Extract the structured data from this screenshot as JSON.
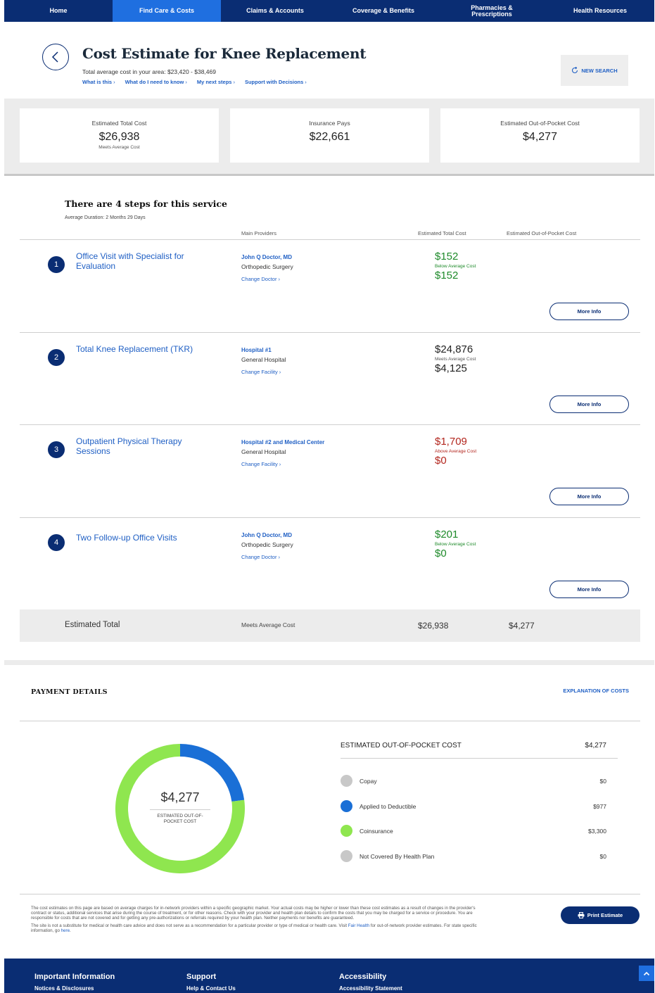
{
  "nav": {
    "items": [
      {
        "label": "Home",
        "active": false
      },
      {
        "label": "Find Care & Costs",
        "active": true
      },
      {
        "label": "Claims & Accounts",
        "active": false
      },
      {
        "label": "Coverage & Benefits",
        "active": false
      },
      {
        "label": "Pharmacies &\nPrescriptions",
        "active": false
      },
      {
        "label": "Health Resources",
        "active": false
      }
    ]
  },
  "header": {
    "title": "Cost Estimate for Knee Replacement",
    "avg_cost_text": "Total average cost in your area: $23,420 - $38,469",
    "links": [
      "What is this",
      "What do I need to know",
      "My next steps",
      "Support with Decisions"
    ],
    "new_search_label": "NEW SEARCH"
  },
  "summary": {
    "cards": [
      {
        "label": "Estimated Total Cost",
        "value": "$26,938",
        "sub": "Meets Average Cost"
      },
      {
        "label": "Insurance Pays",
        "value": "$22,661",
        "sub": ""
      },
      {
        "label": "Estimated Out-of-Pocket Cost",
        "value": "$4,277",
        "sub": ""
      }
    ]
  },
  "steps_section": {
    "title": "There are 4 steps for this service",
    "duration": "Average Duration: 2 Months 29 Days",
    "col_main_providers": "Main Providers",
    "col_total_cost": "Estimated Total Cost",
    "col_oop_cost": "Estimated Out-of-Pocket Cost",
    "more_info_label": "More Info",
    "steps": [
      {
        "number": "1",
        "name": "Office Visit with Specialist for Evaluation",
        "provider": "John Q Doctor, MD",
        "specialty": "Orthopedic Surgery",
        "change_label": "Change Doctor",
        "total": "$152",
        "note": "Below Average Cost",
        "oop": "$152",
        "status": "below"
      },
      {
        "number": "2",
        "name": "Total Knee Replacement (TKR)",
        "provider": "Hospital #1",
        "specialty": "General Hospital",
        "change_label": "Change Facility",
        "total": "$24,876",
        "note": "Meets Average Cost",
        "oop": "$4,125",
        "status": "meets"
      },
      {
        "number": "3",
        "name": "Outpatient Physical Therapy Sessions",
        "provider": "Hospital #2 and Medical Center",
        "specialty": "General Hospital",
        "change_label": "Change Facility",
        "total": "$1,709",
        "note": "Above Average Cost",
        "oop": "$0",
        "status": "above"
      },
      {
        "number": "4",
        "name": "Two Follow-up Office Visits",
        "provider": "John Q Doctor, MD",
        "specialty": "Orthopedic Surgery",
        "change_label": "Change Doctor",
        "total": "$201",
        "note": "Below Average Cost",
        "oop": "$0",
        "status": "below"
      }
    ],
    "estimated_total": {
      "label": "Estimated Total",
      "note": "Meets Average Cost",
      "total": "$26,938",
      "oop": "$4,277"
    }
  },
  "payment": {
    "title": "PAYMENT DETAILS",
    "explanation_link": "EXPLANATION OF COSTS",
    "donut_amount": "$4,277",
    "donut_label": "ESTIMATED OUT-OF-POCKET COST",
    "oop_heading": "ESTIMATED OUT-OF-POCKET COST",
    "oop_total": "$4,277",
    "breakdown": [
      {
        "label": "Copay",
        "value": "$0",
        "amount": 0,
        "color": "#c8c8c8"
      },
      {
        "label": "Applied to Deductible",
        "value": "$977",
        "amount": 977,
        "color": "#1a6fd6"
      },
      {
        "label": "Coinsurance",
        "value": "$3,300",
        "amount": 3300,
        "color": "#8fe64f"
      },
      {
        "label": "Not Covered By Health Plan",
        "value": "$0",
        "amount": 0,
        "color": "#c8c8c8"
      }
    ]
  },
  "disclaimer": {
    "para1": "The cost estimates on this page are based on average charges for in-network providers within a specific geographic market. Your actual costs may be higher or lower than these cost estimates as a result of changes in the provider's contract or status, additional services that arise during the course of treatment, or for other reasons. Check with your provider and health plan details to confirm the costs that you may be charged for a service or procedure. You are responsible for costs that are not covered and for getting any pre-authorizations or referrals required by your health plan. Neither payments nor benefits are guaranteed.",
    "para2_a": "The site is not a substitute for medical or health care advice and does not serve as a recommendation for a particular provider or type of medical or health care. Visit ",
    "para2_link1": "Fair Health",
    "para2_b": " for out-of-network provider estimates. For state specific information, go ",
    "para2_link2": "here",
    "para2_c": ".",
    "print_label": "Print Estimate"
  },
  "footer": {
    "columns": [
      {
        "heading": "Important Information",
        "link": "Notices & Disclosures"
      },
      {
        "heading": "Support",
        "link": "Help & Contact Us"
      },
      {
        "heading": "Accessibility",
        "link": "Accessibility Statement"
      }
    ]
  },
  "colors": {
    "navy": "#0a2d73",
    "accent_blue": "#1f6fe0",
    "link_blue": "#1f5fc4",
    "green": "#1e8a2a",
    "red": "#b3261e"
  }
}
